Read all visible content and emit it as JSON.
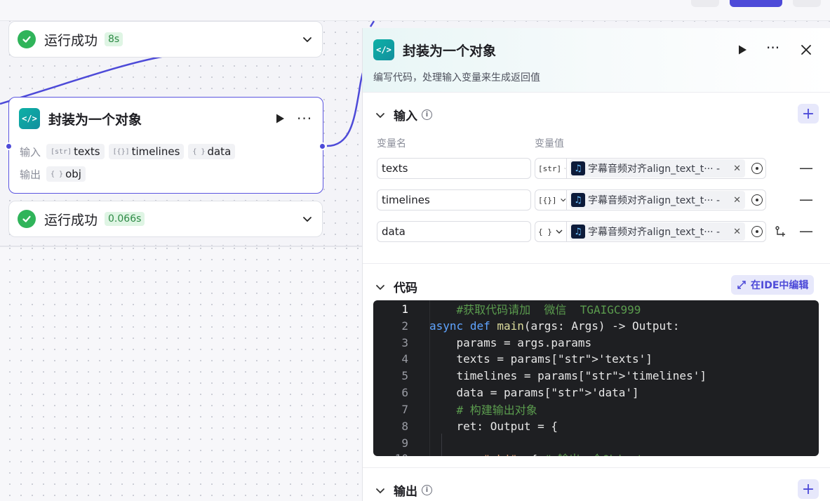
{
  "canvas": {
    "status_top": {
      "text": "运行成功",
      "time": "8s"
    },
    "status_bottom": {
      "text": "运行成功",
      "time": "0.066s"
    },
    "node": {
      "title": "封装为一个对象",
      "input_label": "输入",
      "output_label": "输出",
      "inputs": [
        {
          "type_icon": "[str]",
          "name": "texts"
        },
        {
          "type_icon": "[{}]",
          "name": "timelines"
        },
        {
          "type_icon": "{ }",
          "name": "data"
        }
      ],
      "outputs": [
        {
          "type_icon": "{ }",
          "name": "obj"
        }
      ]
    }
  },
  "panel": {
    "title": "封装为一个对象",
    "description": "编写代码，处理输入变量来生成返回值",
    "input_section": {
      "title": "输入",
      "col_name": "变量名",
      "col_value": "变量值",
      "rows": [
        {
          "name": "texts",
          "type": "[str]",
          "ref": "字幕音频对齐align_text_t··· - texts"
        },
        {
          "name": "timelines",
          "type": "[{}]",
          "ref": "字幕音频对齐align_text_t··· - timelines"
        },
        {
          "name": "data",
          "type": "{ }",
          "ref": "字幕音频对齐align_text_t··· - data"
        }
      ]
    },
    "code_section": {
      "title": "代码",
      "ide_button": "在IDE中编辑",
      "lines": [
        {
          "n": "1",
          "text": "    #获取代码请加  微信  TGAIGC999"
        },
        {
          "n": "2",
          "text": "async def main(args: Args) -> Output:"
        },
        {
          "n": "3",
          "text": "    params = args.params"
        },
        {
          "n": "4",
          "text": "    texts = params['texts']"
        },
        {
          "n": "5",
          "text": "    timelines = params['timelines']"
        },
        {
          "n": "6",
          "text": "    data = params['data']"
        },
        {
          "n": "7",
          "text": "    # 构建输出对象"
        },
        {
          "n": "8",
          "text": "    ret: Output = {"
        },
        {
          "n": "9",
          "text": ""
        },
        {
          "n": "10",
          "text": "        \"obj\": { # 输出一个Object"
        }
      ]
    },
    "output_section": {
      "title": "输出"
    }
  },
  "colors": {
    "accent": "#4d4ad8",
    "success": "#30b45a",
    "code_bg": "#1e1f22"
  }
}
